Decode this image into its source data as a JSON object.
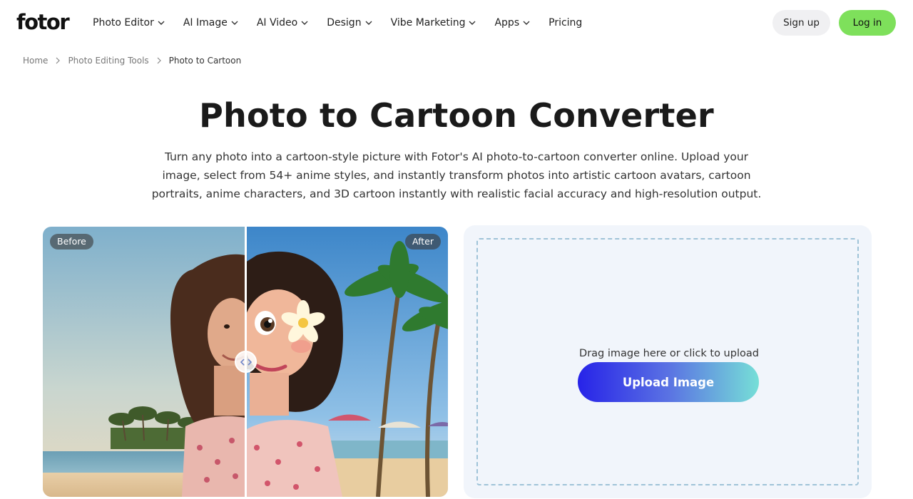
{
  "header": {
    "logo": "fotor",
    "nav": [
      {
        "label": "Photo Editor",
        "has_dropdown": true
      },
      {
        "label": "AI Image",
        "has_dropdown": true
      },
      {
        "label": "AI Video",
        "has_dropdown": true
      },
      {
        "label": "Design",
        "has_dropdown": true
      },
      {
        "label": "Vibe Marketing",
        "has_dropdown": true
      },
      {
        "label": "Apps",
        "has_dropdown": true
      },
      {
        "label": "Pricing",
        "has_dropdown": false
      }
    ],
    "signup_label": "Sign up",
    "login_label": "Log in"
  },
  "breadcrumb": {
    "items": [
      "Home",
      "Photo Editing Tools"
    ],
    "current": "Photo to Cartoon"
  },
  "hero": {
    "title": "Photo to Cartoon Converter",
    "subtitle_lines": [
      "Turn any photo into a cartoon-style picture with Fotor's AI photo-to-cartoon converter online. Upload your",
      "image, select from 54+ anime styles, and instantly transform photos into artistic cartoon avatars, cartoon",
      "portraits, anime characters, and 3D cartoon instantly with realistic facial accuracy and high-resolution output."
    ]
  },
  "compare": {
    "before_label": "Before",
    "after_label": "After",
    "slider_position": 0.5
  },
  "upload": {
    "drop_text": "Drag image here or click to upload",
    "button_label": "Upload Image"
  },
  "colors": {
    "login_bg": "#7ee05b",
    "signup_bg": "#f0f0f2",
    "panel_bg": "#f1f5fb",
    "dropzone_border": "#9fc3d8",
    "upload_gradient_start": "#2723e8",
    "upload_gradient_end": "#76dfd7"
  },
  "icons": {
    "nav_dropdown": "chevron-down-icon",
    "breadcrumb_separator": "chevron-right-icon",
    "slider_handle": "left-right-arrows-icon"
  }
}
